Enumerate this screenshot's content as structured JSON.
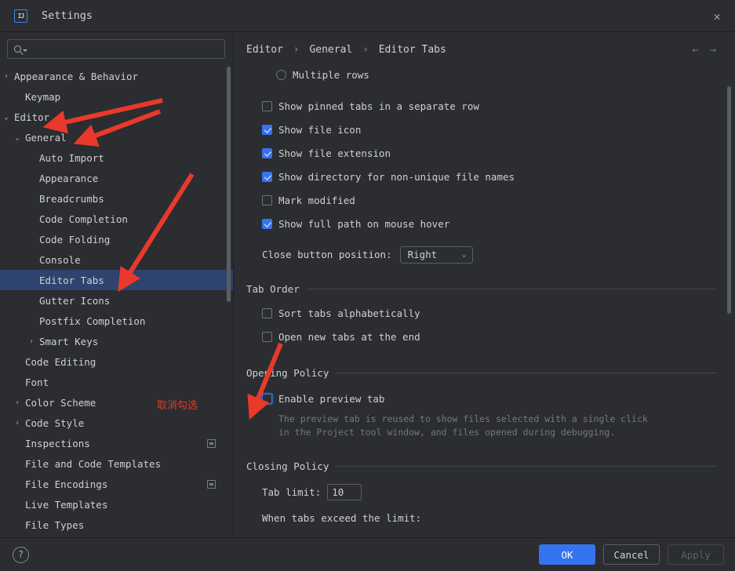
{
  "window": {
    "title": "Settings",
    "logo_text": "IJ",
    "close_icon": "✕"
  },
  "search": {
    "value": "",
    "placeholder": ""
  },
  "sidebar": {
    "items": [
      {
        "label": "Appearance & Behavior",
        "indent": 0,
        "chevron": "›",
        "selected": false,
        "scope_icon": false
      },
      {
        "label": "Keymap",
        "indent": 1,
        "chevron": "",
        "selected": false,
        "scope_icon": false
      },
      {
        "label": "Editor",
        "indent": 0,
        "chevron": "⌄",
        "selected": false,
        "scope_icon": false
      },
      {
        "label": "General",
        "indent": 1,
        "chevron": "⌄",
        "selected": false,
        "scope_icon": false
      },
      {
        "label": "Auto Import",
        "indent": 2,
        "chevron": "",
        "selected": false,
        "scope_icon": false
      },
      {
        "label": "Appearance",
        "indent": 2,
        "chevron": "",
        "selected": false,
        "scope_icon": false
      },
      {
        "label": "Breadcrumbs",
        "indent": 2,
        "chevron": "",
        "selected": false,
        "scope_icon": false
      },
      {
        "label": "Code Completion",
        "indent": 2,
        "chevron": "",
        "selected": false,
        "scope_icon": false
      },
      {
        "label": "Code Folding",
        "indent": 2,
        "chevron": "",
        "selected": false,
        "scope_icon": false
      },
      {
        "label": "Console",
        "indent": 2,
        "chevron": "",
        "selected": false,
        "scope_icon": false
      },
      {
        "label": "Editor Tabs",
        "indent": 2,
        "chevron": "",
        "selected": true,
        "scope_icon": false
      },
      {
        "label": "Gutter Icons",
        "indent": 2,
        "chevron": "",
        "selected": false,
        "scope_icon": false
      },
      {
        "label": "Postfix Completion",
        "indent": 2,
        "chevron": "",
        "selected": false,
        "scope_icon": false
      },
      {
        "label": "Smart Keys",
        "indent": 2,
        "chevron": "›",
        "selected": false,
        "scope_icon": false
      },
      {
        "label": "Code Editing",
        "indent": 1,
        "chevron": "",
        "selected": false,
        "scope_icon": false
      },
      {
        "label": "Font",
        "indent": 1,
        "chevron": "",
        "selected": false,
        "scope_icon": false
      },
      {
        "label": "Color Scheme",
        "indent": 1,
        "chevron": "›",
        "selected": false,
        "scope_icon": false
      },
      {
        "label": "Code Style",
        "indent": 1,
        "chevron": "›",
        "selected": false,
        "scope_icon": false
      },
      {
        "label": "Inspections",
        "indent": 1,
        "chevron": "",
        "selected": false,
        "scope_icon": true
      },
      {
        "label": "File and Code Templates",
        "indent": 1,
        "chevron": "",
        "selected": false,
        "scope_icon": false
      },
      {
        "label": "File Encodings",
        "indent": 1,
        "chevron": "",
        "selected": false,
        "scope_icon": true
      },
      {
        "label": "Live Templates",
        "indent": 1,
        "chevron": "",
        "selected": false,
        "scope_icon": false
      },
      {
        "label": "File Types",
        "indent": 1,
        "chevron": "",
        "selected": false,
        "scope_icon": false
      }
    ]
  },
  "breadcrumb": {
    "parts": [
      "Editor",
      "General",
      "Editor Tabs"
    ],
    "separator": "›",
    "back_icon": "←",
    "forward_icon": "→"
  },
  "main": {
    "radio_multiple_rows": {
      "label": "Multiple rows",
      "selected": false
    },
    "appearance_checks": [
      {
        "label": "Show pinned tabs in a separate row",
        "checked": false
      },
      {
        "label": "Show file icon",
        "checked": true
      },
      {
        "label": "Show file extension",
        "checked": true
      },
      {
        "label": "Show directory for non-unique file names",
        "checked": true
      },
      {
        "label": "Mark modified",
        "checked": false
      },
      {
        "label": "Show full path on mouse hover",
        "checked": true
      }
    ],
    "close_button_position": {
      "label": "Close button position:",
      "value": "Right",
      "chevron": "⌄"
    },
    "tab_order": {
      "title": "Tab Order",
      "checks": [
        {
          "label": "Sort tabs alphabetically",
          "checked": false
        },
        {
          "label": "Open new tabs at the end",
          "checked": false
        }
      ]
    },
    "opening_policy": {
      "title": "Opening Policy",
      "enable_preview": {
        "label": "Enable preview tab",
        "checked": false,
        "focused": true
      },
      "description_line1": "The preview tab is reused to show files selected with a single click",
      "description_line2": "in the Project tool window, and files opened during debugging."
    },
    "closing_policy": {
      "title": "Closing Policy",
      "tab_limit_label": "Tab limit:",
      "tab_limit_value": "10",
      "when_exceed_label": "When tabs exceed the limit:"
    }
  },
  "footer": {
    "help_icon": "?",
    "ok_label": "OK",
    "cancel_label": "Cancel",
    "apply_label": "Apply"
  },
  "annotations": {
    "note_cn": "取消勾选",
    "arrow_color": "#E8392B"
  }
}
